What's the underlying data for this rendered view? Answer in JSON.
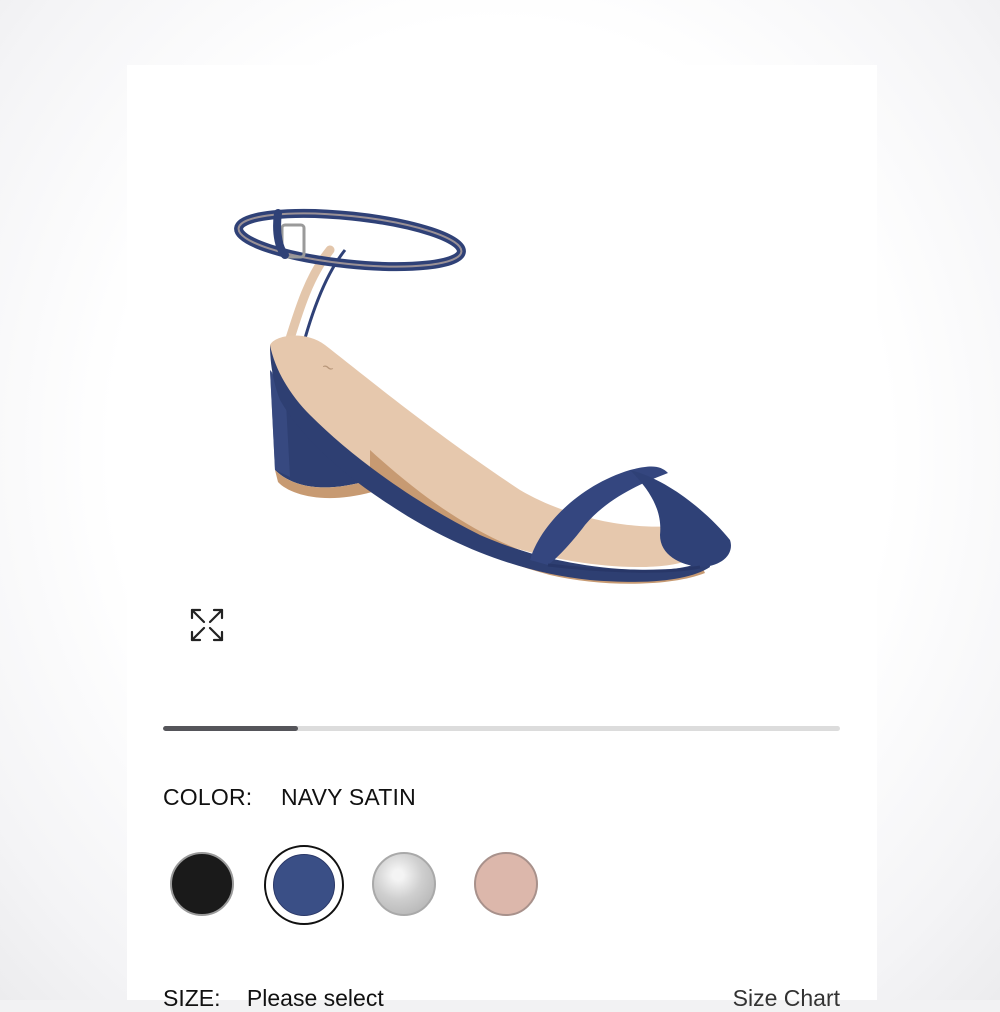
{
  "color_selector": {
    "label": "COLOR:",
    "selected_value": "NAVY SATIN",
    "swatches": [
      {
        "name": "black",
        "color": "#1a1a1a",
        "selected": false
      },
      {
        "name": "navy-satin",
        "color": "#3a4f86",
        "selected": true
      },
      {
        "name": "silver",
        "color": "#c8c8c8",
        "selected": false
      },
      {
        "name": "blush",
        "color": "#dcb7ab",
        "selected": false
      }
    ]
  },
  "gallery": {
    "progress_fraction": 0.2,
    "expand_icon": "expand-arrows-icon"
  },
  "size_selector": {
    "label": "SIZE:",
    "placeholder": "Please select",
    "size_chart_link": "Size Chart"
  },
  "colors": {
    "product": "#2f4177",
    "insole": "#e6c8ad",
    "progress_fill": "#55555a",
    "progress_track": "#dcdcdc"
  }
}
